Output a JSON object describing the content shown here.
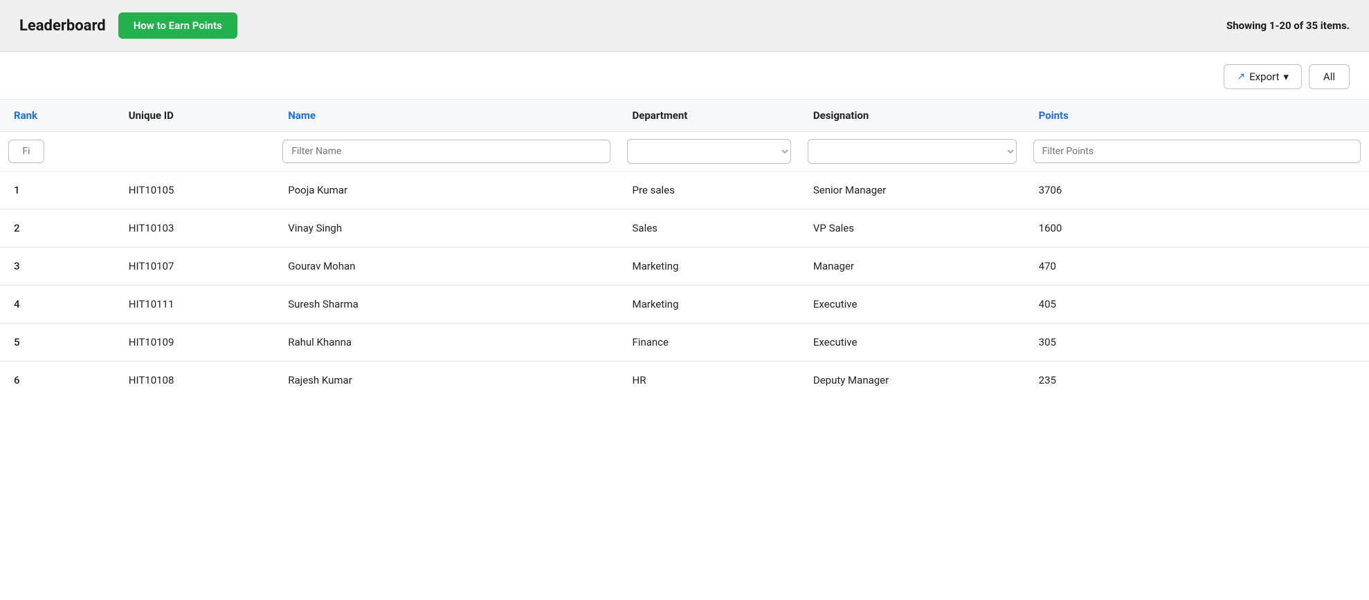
{
  "header": {
    "title": "Leaderboard",
    "earn_points_label": "How to Earn Points",
    "showing_label": "Showing 1-20 of 35 items."
  },
  "toolbar": {
    "export_label": "Export",
    "all_label": "All"
  },
  "table": {
    "columns": [
      {
        "key": "rank",
        "label": "Rank",
        "style": "blue"
      },
      {
        "key": "unique_id",
        "label": "Unique ID",
        "style": "dark"
      },
      {
        "key": "name",
        "label": "Name",
        "style": "blue"
      },
      {
        "key": "department",
        "label": "Department",
        "style": "dark"
      },
      {
        "key": "designation",
        "label": "Designation",
        "style": "dark"
      },
      {
        "key": "points",
        "label": "Points",
        "style": "blue"
      }
    ],
    "filters": {
      "rank_placeholder": "Fi",
      "name_placeholder": "Filter Name",
      "department_placeholder": "",
      "designation_placeholder": "",
      "points_placeholder": "Filter Points"
    },
    "rows": [
      {
        "rank": "1",
        "unique_id": "HIT10105",
        "name": "Pooja Kumar",
        "department": "Pre sales",
        "designation": "Senior Manager",
        "points": "3706"
      },
      {
        "rank": "2",
        "unique_id": "HIT10103",
        "name": "Vinay Singh",
        "department": "Sales",
        "designation": "VP Sales",
        "points": "1600"
      },
      {
        "rank": "3",
        "unique_id": "HIT10107",
        "name": "Gourav Mohan",
        "department": "Marketing",
        "designation": "Manager",
        "points": "470"
      },
      {
        "rank": "4",
        "unique_id": "HIT10111",
        "name": "Suresh Sharma",
        "department": "Marketing",
        "designation": "Executive",
        "points": "405"
      },
      {
        "rank": "5",
        "unique_id": "HIT10109",
        "name": "Rahul Khanna",
        "department": "Finance",
        "designation": "Executive",
        "points": "305"
      },
      {
        "rank": "6",
        "unique_id": "HIT10108",
        "name": "Rajesh Kumar",
        "department": "HR",
        "designation": "Deputy Manager",
        "points": "235"
      }
    ]
  }
}
